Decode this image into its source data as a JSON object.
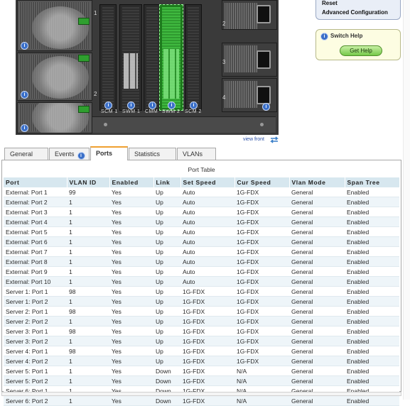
{
  "chassis": {
    "slot_labels": [
      "SCM 1",
      "SWM 1",
      "CMM",
      "SWM 2",
      "SCM 2"
    ],
    "bay_numbers": [
      "1",
      "2",
      "3",
      "4",
      "1",
      "2"
    ]
  },
  "right_menu": {
    "items": [
      "Reset",
      "Advanced Configuration"
    ]
  },
  "help": {
    "title": "Switch Help",
    "button": "Get Help"
  },
  "view_front": "view front",
  "tabs": [
    {
      "label": "General",
      "active": false
    },
    {
      "label": "Events",
      "active": false
    },
    {
      "label": "Ports",
      "active": true
    },
    {
      "label": "Statistics",
      "active": false
    },
    {
      "label": "VLANs",
      "active": false
    }
  ],
  "table": {
    "title": "Port Table",
    "columns": [
      "Port",
      "VLAN ID",
      "Enabled",
      "Link",
      "Set Speed",
      "Cur Speed",
      "Vlan Mode",
      "Span Tree"
    ],
    "rows": [
      [
        "External: Port 1",
        "99",
        "Yes",
        "Up",
        "Auto",
        "1G-FDX",
        "General",
        "Enabled"
      ],
      [
        "External: Port 2",
        "1",
        "Yes",
        "Up",
        "Auto",
        "1G-FDX",
        "General",
        "Enabled"
      ],
      [
        "External: Port 3",
        "1",
        "Yes",
        "Up",
        "Auto",
        "1G-FDX",
        "General",
        "Enabled"
      ],
      [
        "External: Port 4",
        "1",
        "Yes",
        "Up",
        "Auto",
        "1G-FDX",
        "General",
        "Enabled"
      ],
      [
        "External: Port 5",
        "1",
        "Yes",
        "Up",
        "Auto",
        "1G-FDX",
        "General",
        "Enabled"
      ],
      [
        "External: Port 6",
        "1",
        "Yes",
        "Up",
        "Auto",
        "1G-FDX",
        "General",
        "Enabled"
      ],
      [
        "External: Port 7",
        "1",
        "Yes",
        "Up",
        "Auto",
        "1G-FDX",
        "General",
        "Enabled"
      ],
      [
        "External: Port 8",
        "1",
        "Yes",
        "Up",
        "Auto",
        "1G-FDX",
        "General",
        "Enabled"
      ],
      [
        "External: Port 9",
        "1",
        "Yes",
        "Up",
        "Auto",
        "1G-FDX",
        "General",
        "Enabled"
      ],
      [
        "External: Port 10",
        "1",
        "Yes",
        "Up",
        "Auto",
        "1G-FDX",
        "General",
        "Enabled"
      ],
      [
        "Server 1: Port 1",
        "98",
        "Yes",
        "Up",
        "1G-FDX",
        "1G-FDX",
        "General",
        "Enabled"
      ],
      [
        "Server 1: Port 2",
        "1",
        "Yes",
        "Up",
        "1G-FDX",
        "1G-FDX",
        "General",
        "Enabled"
      ],
      [
        "Server 2: Port 1",
        "98",
        "Yes",
        "Up",
        "1G-FDX",
        "1G-FDX",
        "General",
        "Enabled"
      ],
      [
        "Server 2: Port 2",
        "1",
        "Yes",
        "Up",
        "1G-FDX",
        "1G-FDX",
        "General",
        "Enabled"
      ],
      [
        "Server 3: Port 1",
        "98",
        "Yes",
        "Up",
        "1G-FDX",
        "1G-FDX",
        "General",
        "Enabled"
      ],
      [
        "Server 3: Port 2",
        "1",
        "Yes",
        "Up",
        "1G-FDX",
        "1G-FDX",
        "General",
        "Enabled"
      ],
      [
        "Server 4: Port 1",
        "98",
        "Yes",
        "Up",
        "1G-FDX",
        "1G-FDX",
        "General",
        "Enabled"
      ],
      [
        "Server 4: Port 2",
        "1",
        "Yes",
        "Up",
        "1G-FDX",
        "1G-FDX",
        "General",
        "Enabled"
      ],
      [
        "Server 5: Port 1",
        "1",
        "Yes",
        "Down",
        "1G-FDX",
        "N/A",
        "General",
        "Enabled"
      ],
      [
        "Server 5: Port 2",
        "1",
        "Yes",
        "Down",
        "1G-FDX",
        "N/A",
        "General",
        "Enabled"
      ],
      [
        "Server 6: Port 1",
        "1",
        "Yes",
        "Down",
        "1G-FDX",
        "N/A",
        "General",
        "Enabled"
      ],
      [
        "Server 6: Port 2",
        "1",
        "Yes",
        "Down",
        "1G-FDX",
        "N/A",
        "General",
        "Enabled"
      ]
    ]
  },
  "colors": {
    "header_bg": "#d7e7ef",
    "active_tab_accent": "#f0a030",
    "selected_module": "#2f9a2f",
    "help_button": "#76c84a"
  },
  "icons": {
    "info": "info-icon",
    "view_front": "rotate-arrows-icon"
  }
}
